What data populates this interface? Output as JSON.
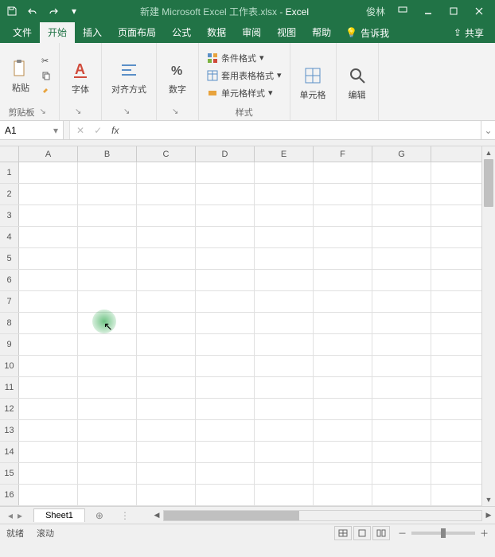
{
  "title": {
    "filename": "新建 Microsoft Excel 工作表.xlsx",
    "separator": " - ",
    "app": "Excel",
    "user": "俊林"
  },
  "tabs": {
    "file": "文件",
    "home": "开始",
    "insert": "插入",
    "layout": "页面布局",
    "formulas": "公式",
    "data": "数据",
    "review": "审阅",
    "view": "视图",
    "help": "帮助",
    "tellme": "告诉我",
    "share": "共享"
  },
  "ribbon": {
    "paste": "粘贴",
    "clipboard": "剪贴板",
    "font": "字体",
    "alignment": "对齐方式",
    "number": "数字",
    "condFormat": "条件格式",
    "tableFormat": "套用表格格式",
    "cellStyles": "单元格样式",
    "styles": "样式",
    "cells": "单元格",
    "editing": "编辑"
  },
  "nameBox": "A1",
  "columns": [
    "A",
    "B",
    "C",
    "D",
    "E",
    "F",
    "G"
  ],
  "rows": [
    "1",
    "2",
    "3",
    "4",
    "5",
    "6",
    "7",
    "8",
    "9",
    "10",
    "11",
    "12",
    "13",
    "14",
    "15",
    "16"
  ],
  "sheet": {
    "name": "Sheet1"
  },
  "status": {
    "ready": "就绪",
    "scroll": "滚动"
  },
  "zoom": {
    "minus": "－",
    "plus": "＋"
  },
  "chart_data": null
}
